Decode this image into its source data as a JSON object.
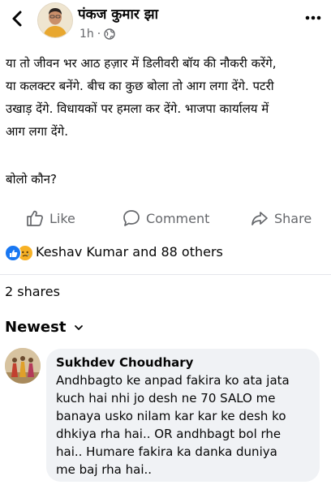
{
  "post": {
    "author": "पंकज कुमार झा",
    "time": "1h",
    "lines": [
      "या तो जीवन भर आठ हज़ार में डिलीवरी बॉय की नौकरी करेंगे,",
      "या कलक्टर बनेंगे. बीच का कुछ बोला तो आग लगा देंगे. पटरी",
      "उखाड़ देंगे. विधायकों पर हमला कर देंगे. भाजपा कार्यालय में",
      "आग लगा देंगे."
    ],
    "question": "बोलो कौन?"
  },
  "actions": {
    "like": "Like",
    "comment": "Comment",
    "share": "Share"
  },
  "reactions": {
    "names": "Keshav Kumar and 88 others",
    "icons": [
      "like-icon",
      "sad-icon"
    ]
  },
  "shares": "2 shares",
  "sort": {
    "label": "Newest"
  },
  "comment": {
    "author": "Sukhdev Choudhary",
    "lines": [
      "Andhbagto ke anpad fakira ko ata jata",
      "kuch hai nhi jo desh ne 70 SALO me",
      "banaya usko nilam kar kar ke desh ko",
      "dhkiya rha hai.. OR andhbagt bol rhe",
      "hai.. Humare fakira ka danka duniya",
      "me baj rha hai.."
    ]
  },
  "colors": {
    "like_blue": "#1877f2",
    "secondary_text": "#65676b",
    "bubble": "#f0f2f5"
  }
}
